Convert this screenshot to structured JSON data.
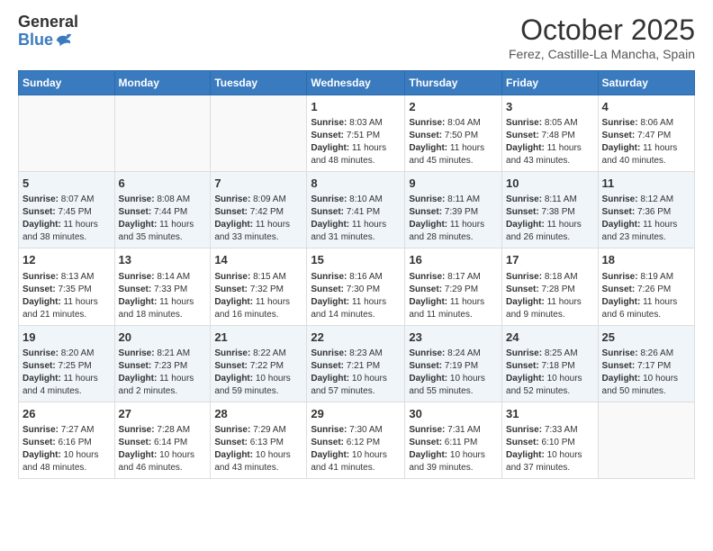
{
  "header": {
    "logo": {
      "general": "General",
      "blue": "Blue"
    },
    "title": "October 2025",
    "location": "Ferez, Castille-La Mancha, Spain"
  },
  "days_of_week": [
    "Sunday",
    "Monday",
    "Tuesday",
    "Wednesday",
    "Thursday",
    "Friday",
    "Saturday"
  ],
  "weeks": [
    [
      {
        "day": "",
        "content": ""
      },
      {
        "day": "",
        "content": ""
      },
      {
        "day": "",
        "content": ""
      },
      {
        "day": "1",
        "content": "Sunrise: 8:03 AM\nSunset: 7:51 PM\nDaylight: 11 hours and 48 minutes."
      },
      {
        "day": "2",
        "content": "Sunrise: 8:04 AM\nSunset: 7:50 PM\nDaylight: 11 hours and 45 minutes."
      },
      {
        "day": "3",
        "content": "Sunrise: 8:05 AM\nSunset: 7:48 PM\nDaylight: 11 hours and 43 minutes."
      },
      {
        "day": "4",
        "content": "Sunrise: 8:06 AM\nSunset: 7:47 PM\nDaylight: 11 hours and 40 minutes."
      }
    ],
    [
      {
        "day": "5",
        "content": "Sunrise: 8:07 AM\nSunset: 7:45 PM\nDaylight: 11 hours and 38 minutes."
      },
      {
        "day": "6",
        "content": "Sunrise: 8:08 AM\nSunset: 7:44 PM\nDaylight: 11 hours and 35 minutes."
      },
      {
        "day": "7",
        "content": "Sunrise: 8:09 AM\nSunset: 7:42 PM\nDaylight: 11 hours and 33 minutes."
      },
      {
        "day": "8",
        "content": "Sunrise: 8:10 AM\nSunset: 7:41 PM\nDaylight: 11 hours and 31 minutes."
      },
      {
        "day": "9",
        "content": "Sunrise: 8:11 AM\nSunset: 7:39 PM\nDaylight: 11 hours and 28 minutes."
      },
      {
        "day": "10",
        "content": "Sunrise: 8:11 AM\nSunset: 7:38 PM\nDaylight: 11 hours and 26 minutes."
      },
      {
        "day": "11",
        "content": "Sunrise: 8:12 AM\nSunset: 7:36 PM\nDaylight: 11 hours and 23 minutes."
      }
    ],
    [
      {
        "day": "12",
        "content": "Sunrise: 8:13 AM\nSunset: 7:35 PM\nDaylight: 11 hours and 21 minutes."
      },
      {
        "day": "13",
        "content": "Sunrise: 8:14 AM\nSunset: 7:33 PM\nDaylight: 11 hours and 18 minutes."
      },
      {
        "day": "14",
        "content": "Sunrise: 8:15 AM\nSunset: 7:32 PM\nDaylight: 11 hours and 16 minutes."
      },
      {
        "day": "15",
        "content": "Sunrise: 8:16 AM\nSunset: 7:30 PM\nDaylight: 11 hours and 14 minutes."
      },
      {
        "day": "16",
        "content": "Sunrise: 8:17 AM\nSunset: 7:29 PM\nDaylight: 11 hours and 11 minutes."
      },
      {
        "day": "17",
        "content": "Sunrise: 8:18 AM\nSunset: 7:28 PM\nDaylight: 11 hours and 9 minutes."
      },
      {
        "day": "18",
        "content": "Sunrise: 8:19 AM\nSunset: 7:26 PM\nDaylight: 11 hours and 6 minutes."
      }
    ],
    [
      {
        "day": "19",
        "content": "Sunrise: 8:20 AM\nSunset: 7:25 PM\nDaylight: 11 hours and 4 minutes."
      },
      {
        "day": "20",
        "content": "Sunrise: 8:21 AM\nSunset: 7:23 PM\nDaylight: 11 hours and 2 minutes."
      },
      {
        "day": "21",
        "content": "Sunrise: 8:22 AM\nSunset: 7:22 PM\nDaylight: 10 hours and 59 minutes."
      },
      {
        "day": "22",
        "content": "Sunrise: 8:23 AM\nSunset: 7:21 PM\nDaylight: 10 hours and 57 minutes."
      },
      {
        "day": "23",
        "content": "Sunrise: 8:24 AM\nSunset: 7:19 PM\nDaylight: 10 hours and 55 minutes."
      },
      {
        "day": "24",
        "content": "Sunrise: 8:25 AM\nSunset: 7:18 PM\nDaylight: 10 hours and 52 minutes."
      },
      {
        "day": "25",
        "content": "Sunrise: 8:26 AM\nSunset: 7:17 PM\nDaylight: 10 hours and 50 minutes."
      }
    ],
    [
      {
        "day": "26",
        "content": "Sunrise: 7:27 AM\nSunset: 6:16 PM\nDaylight: 10 hours and 48 minutes."
      },
      {
        "day": "27",
        "content": "Sunrise: 7:28 AM\nSunset: 6:14 PM\nDaylight: 10 hours and 46 minutes."
      },
      {
        "day": "28",
        "content": "Sunrise: 7:29 AM\nSunset: 6:13 PM\nDaylight: 10 hours and 43 minutes."
      },
      {
        "day": "29",
        "content": "Sunrise: 7:30 AM\nSunset: 6:12 PM\nDaylight: 10 hours and 41 minutes."
      },
      {
        "day": "30",
        "content": "Sunrise: 7:31 AM\nSunset: 6:11 PM\nDaylight: 10 hours and 39 minutes."
      },
      {
        "day": "31",
        "content": "Sunrise: 7:33 AM\nSunset: 6:10 PM\nDaylight: 10 hours and 37 minutes."
      },
      {
        "day": "",
        "content": ""
      }
    ]
  ]
}
